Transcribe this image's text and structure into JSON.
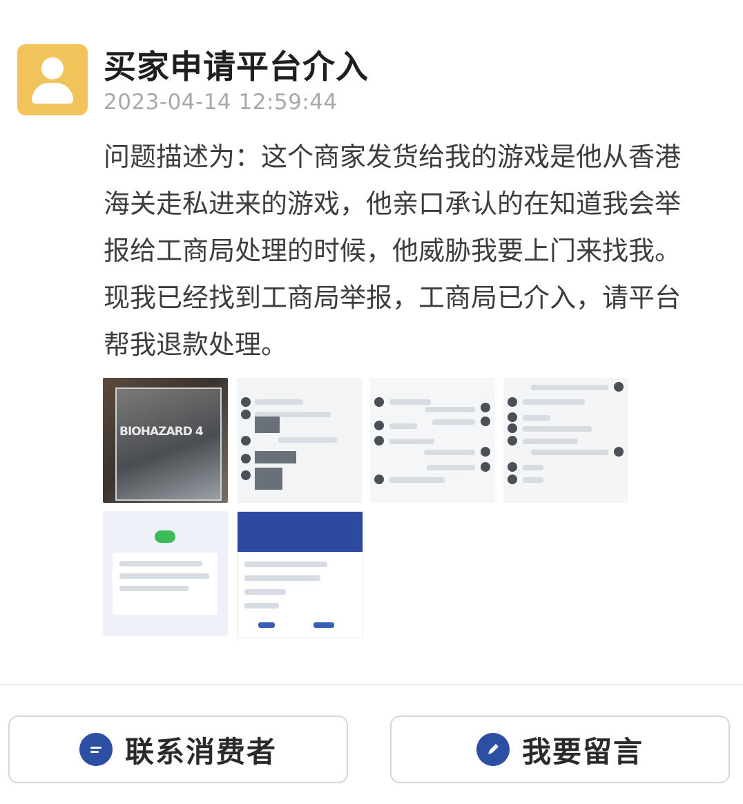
{
  "header": {
    "title": "买家申请平台介入",
    "timestamp": "2023-04-14 12:59:44"
  },
  "description": {
    "lines": [
      "问题描述为：这个商家发货给我的游戏是他从香港",
      "海关走私进来的游戏，他亲口承认的在知道我会举",
      "报给工商局处理的时候，他威胁我要上门来找我。",
      "现我已经找到工商局举报，工商局已介入，请平台",
      "帮我退款处理。"
    ]
  },
  "attachments": {
    "photo_label": "BIOHAZARD 4"
  },
  "actions": {
    "contact_label": "联系消费者",
    "message_label": "我要留言"
  },
  "colors": {
    "avatar_bg": "#f1c35b",
    "accent": "#2d4fa3"
  },
  "icons": {
    "avatar": "user-icon",
    "contact": "chat-icon",
    "message": "edit-icon"
  }
}
